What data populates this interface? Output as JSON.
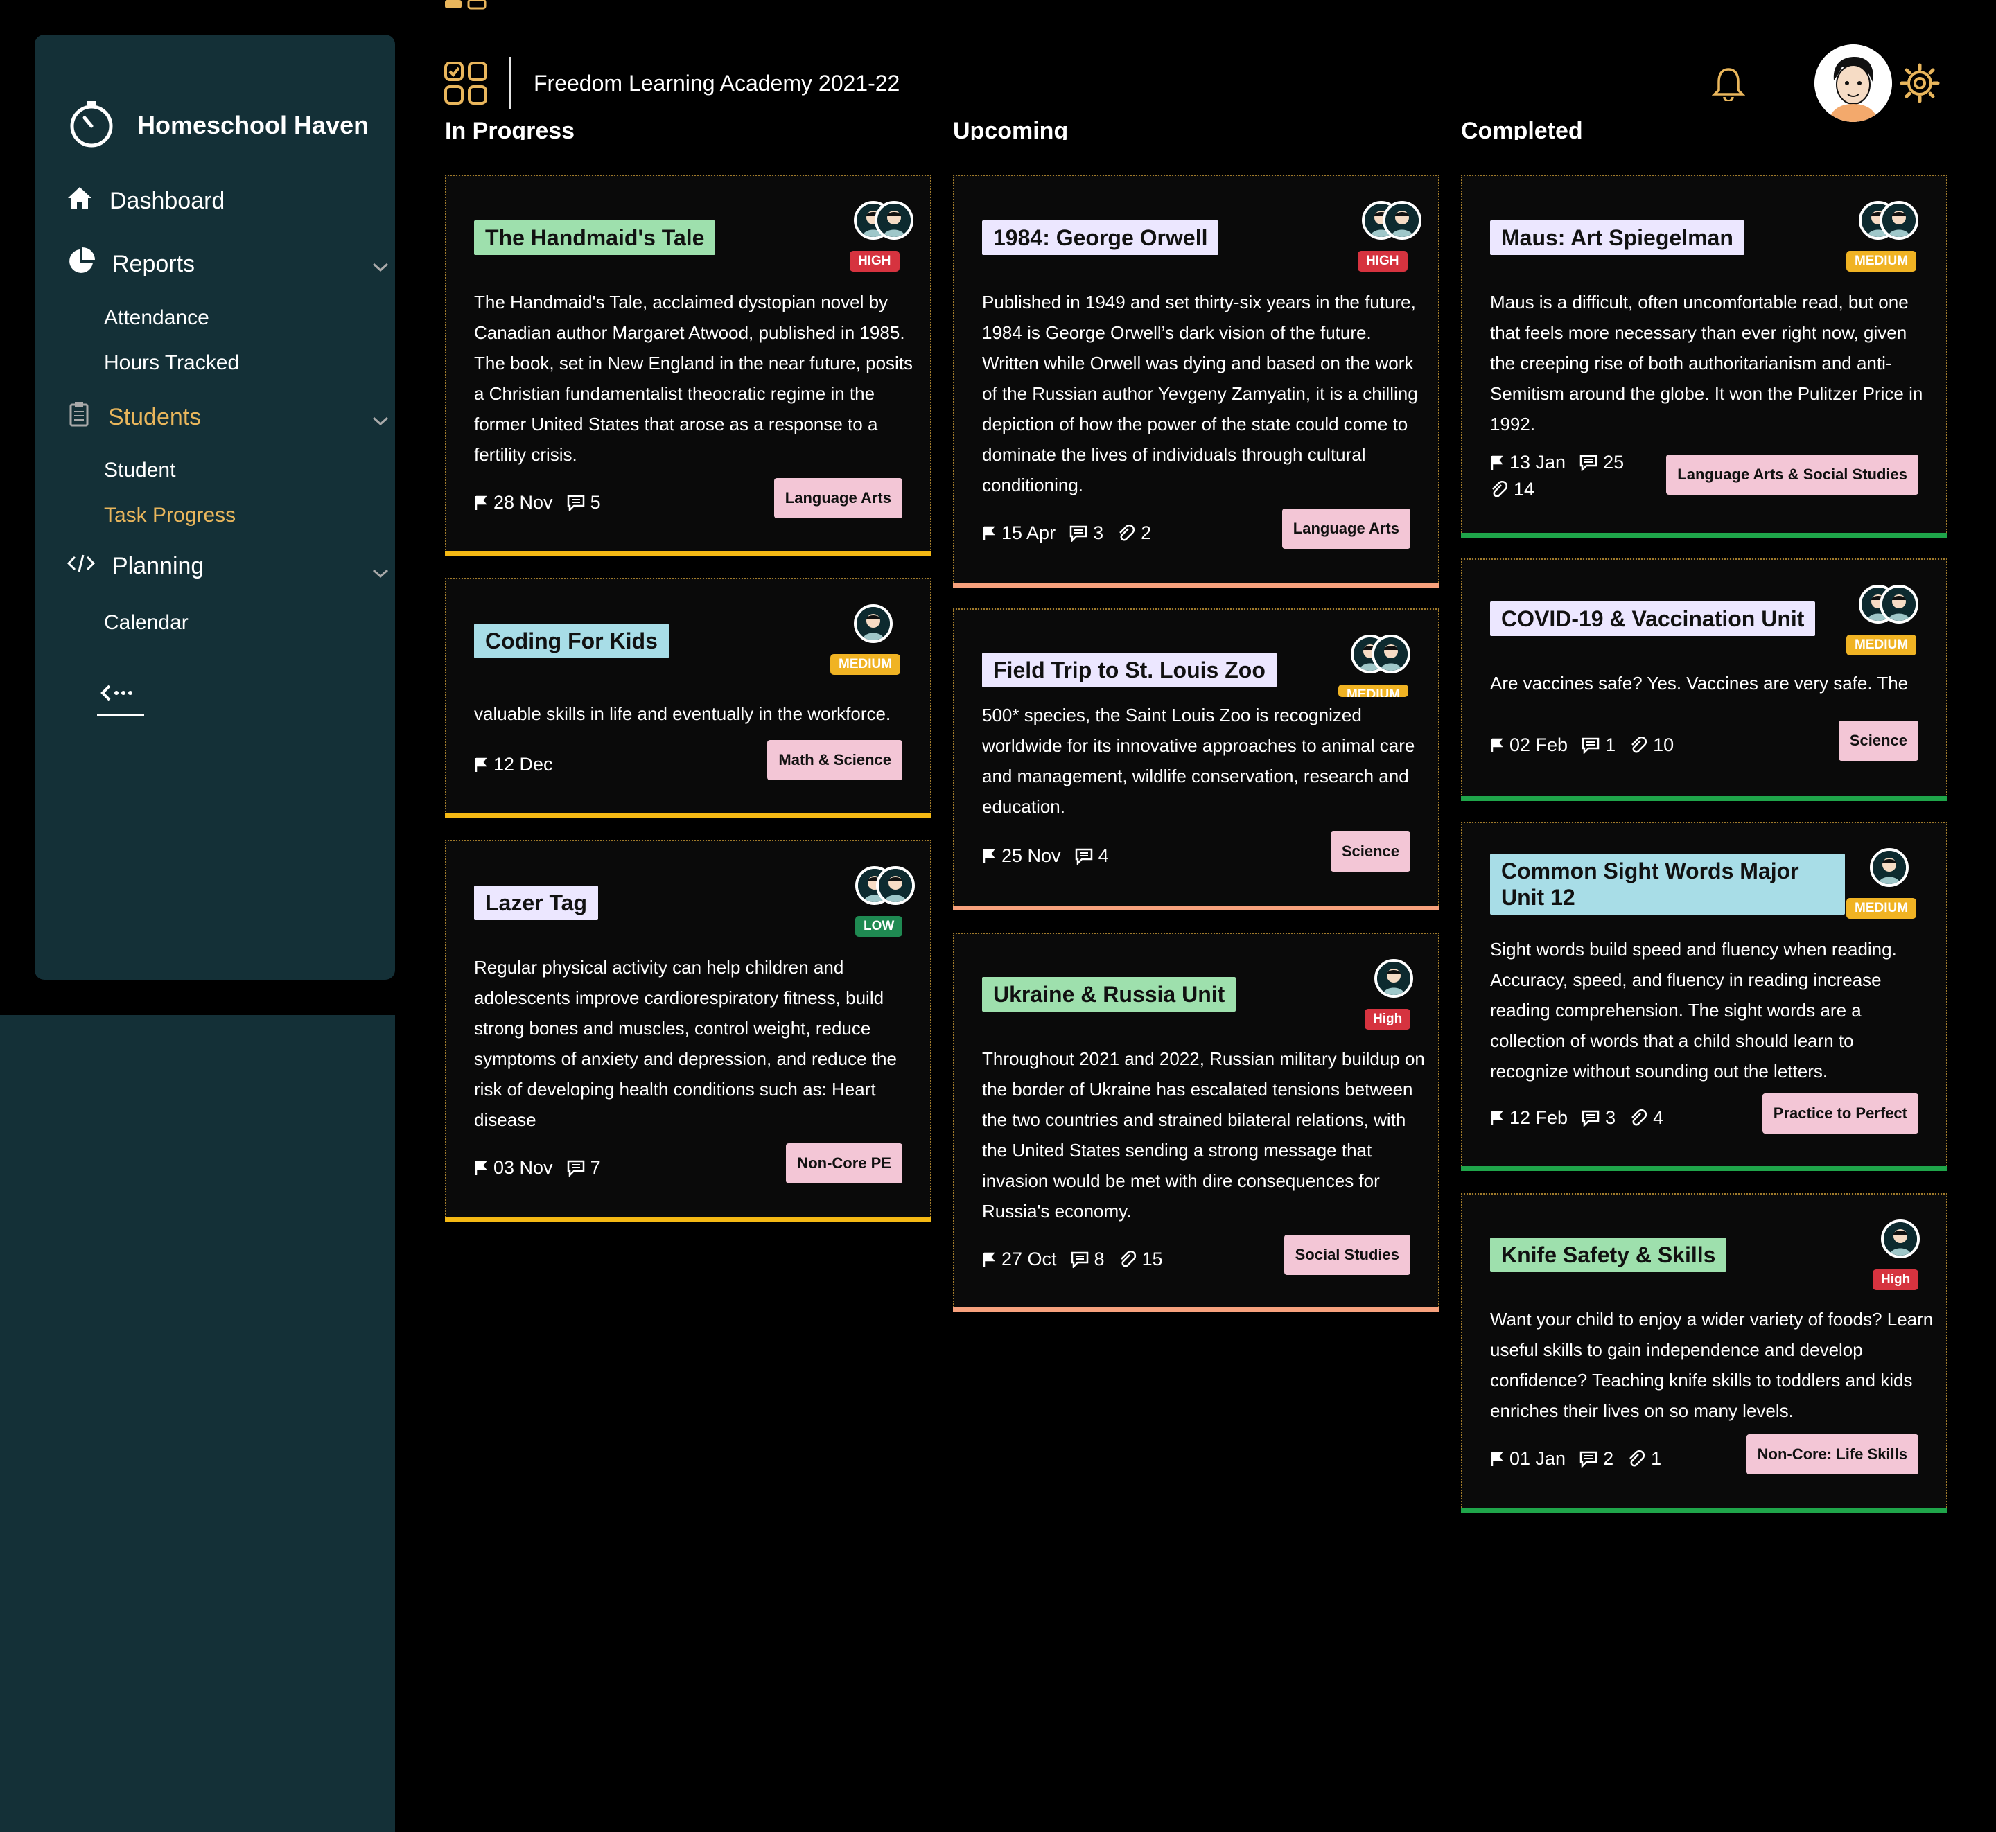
{
  "app": {
    "name": "Homeschool Haven",
    "school": "Freedom Learning Academy 2021-22"
  },
  "sidebar": {
    "dashboard": "Dashboard",
    "reports": "Reports",
    "reports_items": [
      "Attendance",
      "Hours Tracked"
    ],
    "students": "Students",
    "students_items": [
      "Student",
      "Task Progress"
    ],
    "planning": "Planning",
    "planning_items": [
      "Calendar"
    ]
  },
  "columns": [
    {
      "heading": "In Progress",
      "cards": [
        {
          "title": "The Handmaid's Tale",
          "priority": "HIGH",
          "desc": "The Handmaid's Tale, acclaimed dystopian novel by Canadian author Margaret Atwood, published in 1985. The book, set in New England in the near future, posits a Christian fundamentalist theocratic regime in the former United States that arose as a response to a fertility crisis.",
          "date": "28 Nov",
          "comments": "5",
          "tag": "Language Arts"
        },
        {
          "title": "Coding For Kids",
          "priority": "MEDIUM",
          "desc": "valuable skills in life and eventually in the workforce.",
          "date": "12 Dec",
          "tag": "Math & Science"
        },
        {
          "title": "Lazer Tag",
          "priority": "LOW",
          "desc": "Regular physical activity can help children and adolescents improve cardiorespiratory fitness, build strong bones and muscles, control weight, reduce symptoms of anxiety and depression, and reduce the risk of developing health conditions such as: Heart disease",
          "date": "03 Nov",
          "comments": "7",
          "tag": "Non-Core PE"
        }
      ]
    },
    {
      "heading": "Upcoming",
      "cards": [
        {
          "title": "1984: George Orwell",
          "priority": "HIGH",
          "desc": "Published in 1949 and set thirty-six years in the future, 1984 is George Orwell’s dark vision of the future. Written while Orwell was dying and based on the work of the Russian author Yevgeny Zamyatin, it is a chilling depiction of how the power of the state could come to dominate the lives of individuals through cultural conditioning.",
          "date": "15 Apr",
          "comments": "3",
          "links": "2",
          "tag": "Language Arts"
        },
        {
          "title": "Field Trip to St. Louis Zoo",
          "priority": "MEDIUM",
          "desc": "500* species, the Saint Louis Zoo is recognized worldwide for its innovative approaches to animal care and management, wildlife conservation, research and education.",
          "date": "25 Nov",
          "comments": "4",
          "tag": "Science"
        },
        {
          "title": "Ukraine & Russia Unit",
          "priority": "High",
          "desc": "Throughout 2021 and 2022, Russian military buildup on the border of Ukraine has escalated tensions between the two countries and strained bilateral relations, with the United States sending a strong message that invasion would be met with dire consequences for Russia's economy.",
          "date": "27 Oct",
          "comments": "8",
          "links": "15",
          "tag": "Social Studies"
        }
      ]
    },
    {
      "heading": "Completed",
      "cards": [
        {
          "title": "Maus: Art Spiegelman",
          "priority": "MEDIUM",
          "desc": "Maus is a difficult, often uncomfortable read, but one that feels more necessary than ever right now, given the creeping rise of both authoritarianism and anti-Semitism around the globe. It won the Pulitzer Price in 1992.",
          "date": "13 Jan",
          "comments": "25",
          "links": "14",
          "tag": "Language Arts & Social Studies"
        },
        {
          "title": "COVID-19 & Vaccination Unit",
          "priority": "MEDIUM",
          "desc": "Are vaccines safe? Yes. Vaccines are very safe. The",
          "date": "02 Feb",
          "comments": "1",
          "links": "10",
          "tag": "Science"
        },
        {
          "title": "Common Sight Words Major Unit 12",
          "priority": "MEDIUM",
          "desc": "Sight words build speed and fluency when reading. Accuracy, speed, and fluency in reading increase reading comprehension. The sight words are a collection of words that a child should learn to recognize without sounding out the letters.",
          "date": "12 Feb",
          "comments": "3",
          "links": "4",
          "tag": "Practice to Perfect"
        },
        {
          "title": "Knife Safety & Skills",
          "priority": "High",
          "desc": "Want your child to enjoy a wider variety of foods? Learn useful skills to gain independence and develop confidence? Teaching knife skills to toddlers and kids enriches their lives on so many levels.",
          "date": "01 Jan",
          "comments": "2",
          "links": "1",
          "tag": "Non-Core: Life Skills"
        }
      ]
    }
  ],
  "icons": {
    "logo": "stopwatch-icon",
    "dashboard": "home-icon",
    "reports": "pie-chart-icon",
    "students": "clipboard-icon",
    "planning": "code-icon",
    "collapse": "collapse-icon",
    "apps": "grid-icon",
    "notifications": "bell-icon",
    "settings": "gear-icon"
  },
  "colors": {
    "sidebar": "#143037",
    "accent": "#e9b65c",
    "high": "#d6333f",
    "medium": "#f0b323",
    "low": "#1f8a52",
    "tag": "#f3c6d6"
  }
}
